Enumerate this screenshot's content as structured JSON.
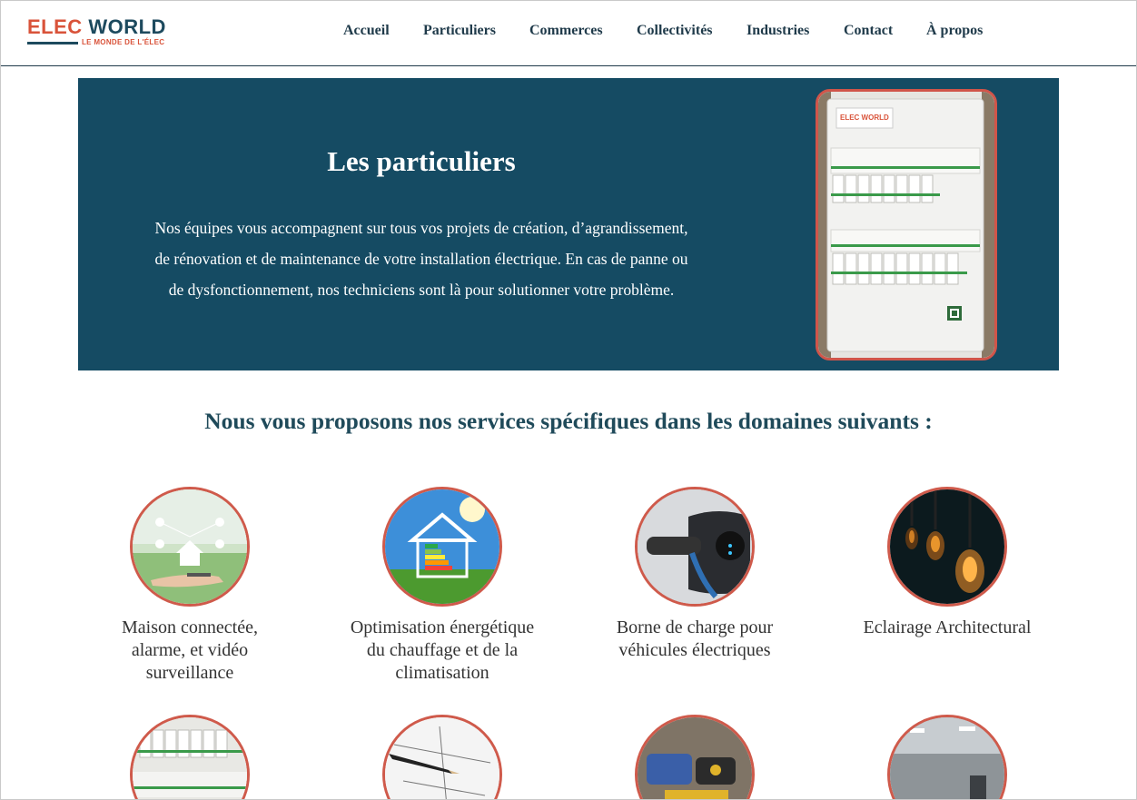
{
  "brand": {
    "part1": "ELEC",
    "part2": "WORLD",
    "tagline": "LE MONDE DE L'ÉLEC"
  },
  "nav": [
    "Accueil",
    "Particuliers",
    "Commerces",
    "Collectivités",
    "Industries",
    "Contact",
    "À propos"
  ],
  "hero": {
    "title": "Les particuliers",
    "lines": [
      "Nos équipes vous accompagnent sur tous vos projets de création, d’agrandissement,",
      "de rénovation et de maintenance de votre installation électrique. En cas de panne ou",
      "de dysfonctionnement, nos techniciens sont là pour solutionner votre problème."
    ],
    "panel_label": "ELEC WORLD"
  },
  "section_title": "Nous vous proposons nos services spécifiques dans les domaines suivants :",
  "services": [
    {
      "icon": "smart-home-image",
      "lines": [
        "Maison connectée,",
        "alarme, et vidéo",
        "surveillance"
      ]
    },
    {
      "icon": "energy-house-image",
      "lines": [
        "Optimisation énergétique",
        "du chauffage et de la",
        "climatisation"
      ]
    },
    {
      "icon": "ev-charger-image",
      "lines": [
        "Borne de charge pour",
        "véhicules électriques"
      ]
    },
    {
      "icon": "light-bulb-image",
      "lines": [
        "Eclairage Architectural"
      ]
    }
  ],
  "colors": {
    "accent": "#cf5a4b",
    "brand_dark": "#154b63",
    "text_dark": "#1f3a4a"
  }
}
